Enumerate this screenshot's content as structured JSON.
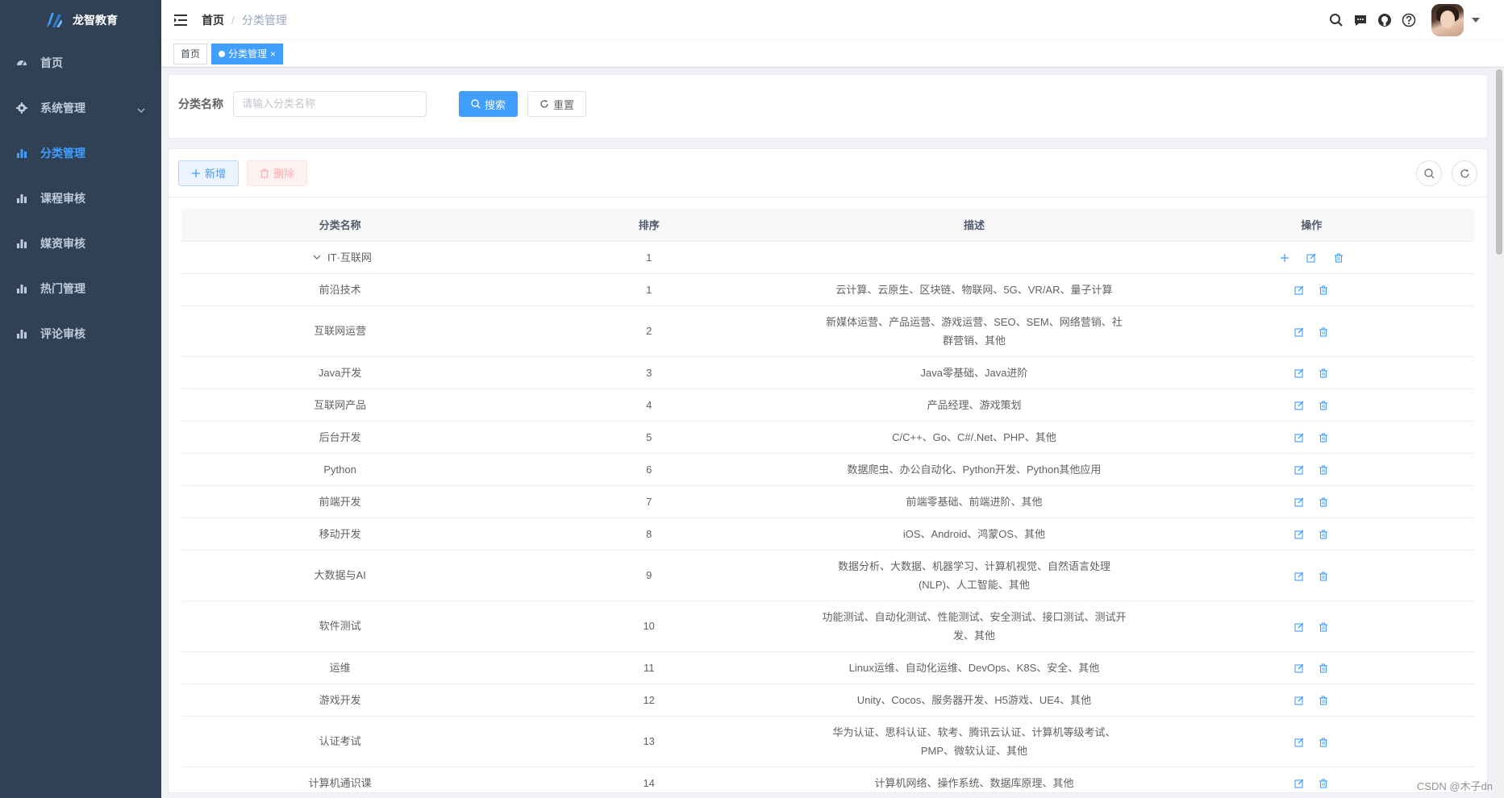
{
  "app": {
    "name": "龙智教育"
  },
  "sidebar": {
    "items": [
      {
        "label": "首页",
        "icon": "dashboard-icon",
        "active": false
      },
      {
        "label": "系统管理",
        "icon": "gear-icon",
        "active": false,
        "has_children": true
      },
      {
        "label": "分类管理",
        "icon": "bar-chart-icon",
        "active": true
      },
      {
        "label": "课程审核",
        "icon": "bar-chart-icon",
        "active": false
      },
      {
        "label": "媒资审核",
        "icon": "bar-chart-icon",
        "active": false
      },
      {
        "label": "热门管理",
        "icon": "bar-chart-icon",
        "active": false
      },
      {
        "label": "评论审核",
        "icon": "bar-chart-icon",
        "active": false
      }
    ]
  },
  "header": {
    "breadcrumb": {
      "home": "首页",
      "separator": "/",
      "current": "分类管理"
    }
  },
  "tags": [
    {
      "label": "首页",
      "active": false
    },
    {
      "label": "分类管理",
      "active": true,
      "close": "×"
    }
  ],
  "search": {
    "label": "分类名称",
    "placeholder": "请输入分类名称",
    "search_btn": "搜索",
    "reset_btn": "重置"
  },
  "toolbar": {
    "add_btn": "新增",
    "delete_btn": "删除"
  },
  "table": {
    "headers": [
      "分类名称",
      "排序",
      "描述",
      "操作"
    ],
    "parent": {
      "name": "IT·互联网",
      "sort": "1",
      "desc": ""
    },
    "rows": [
      {
        "name": "前沿技术",
        "sort": "1",
        "desc": "云计算、云原生、区块链、物联网、5G、VR/AR、量子计算"
      },
      {
        "name": "互联网运营",
        "sort": "2",
        "desc": "新媒体运营、产品运营、游戏运营、SEO、SEM、网络营销、社群营销、其他"
      },
      {
        "name": "Java开发",
        "sort": "3",
        "desc": "Java零基础、Java进阶"
      },
      {
        "name": "互联网产品",
        "sort": "4",
        "desc": "产品经理、游戏策划"
      },
      {
        "name": "后台开发",
        "sort": "5",
        "desc": "C/C++、Go、C#/.Net、PHP、其他"
      },
      {
        "name": "Python",
        "sort": "6",
        "desc": "数据爬虫、办公自动化、Python开发、Python其他应用"
      },
      {
        "name": "前端开发",
        "sort": "7",
        "desc": "前端零基础、前端进阶、其他"
      },
      {
        "name": "移动开发",
        "sort": "8",
        "desc": "iOS、Android、鸿蒙OS、其他"
      },
      {
        "name": "大数据与AI",
        "sort": "9",
        "desc": "数据分析、大数据、机器学习、计算机视觉、自然语言处理(NLP)、人工智能、其他"
      },
      {
        "name": "软件测试",
        "sort": "10",
        "desc": "功能测试、自动化测试、性能测试、安全测试、接口测试、测试开发、其他"
      },
      {
        "name": "运维",
        "sort": "11",
        "desc": "Linux运维、自动化运维、DevOps、K8S、安全、其他"
      },
      {
        "name": "游戏开发",
        "sort": "12",
        "desc": "Unity、Cocos、服务器开发、H5游戏、UE4、其他"
      },
      {
        "name": "认证考试",
        "sort": "13",
        "desc": "华为认证、思科认证、软考、腾讯云认证、计算机等级考试、PMP、微软认证、其他"
      },
      {
        "name": "计算机通识课",
        "sort": "14",
        "desc": "计算机网络、操作系统、数据库原理、其他"
      }
    ]
  },
  "watermark": "CSDN @木子dn",
  "colors": {
    "sidebar_bg": "#304156",
    "primary": "#409eff",
    "danger_light": "#fef0f0"
  }
}
